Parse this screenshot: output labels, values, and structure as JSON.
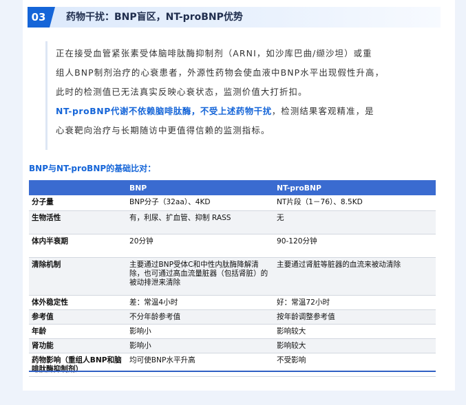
{
  "section": {
    "number": "03",
    "title": "药物干扰：BNP盲区，NT-proBNP优势"
  },
  "intro": {
    "line1": "正在接受血管紧张素受体脑啡肽酶抑制剂（ARNI，如沙库巴曲/缬沙坦）或重",
    "line2": "组人BNP制剂治疗的心衰患者，外源性药物会使血液中BNP水平出现假性升高，",
    "line3": "此时的检测值已无法真实反映心衰状态，监测价值大打折扣。",
    "highlight": "NT-proBNP代谢不依赖脑啡肽酶，不受上述药物干扰",
    "line4_rest": "，检测结果客观精准，是",
    "line5": "心衰靶向治疗与长期随访中更值得信赖的监测指标。"
  },
  "comparison": {
    "title": "BNP与NT-proBNP的基础比对：",
    "headers": [
      "",
      "BNP",
      "NT-proBNP"
    ],
    "rows": [
      [
        "分子量",
        "BNP分子（32aa）、4KD",
        "NT片段（1－76）、8.5KD"
      ],
      [
        "生物活性",
        "有，利尿、扩血管、抑制 RASS",
        "无"
      ],
      [
        "体内半衰期",
        "20分钟",
        "90-120分钟"
      ],
      [
        "清除机制",
        "主要通过BNP受体C和中性内肽酶降解清除，也可通过高血流量脏器（包括肾脏）的被动排泄来清除",
        "主要通过肾脏等脏器的血流来被动清除"
      ],
      [
        "体外稳定性",
        "差：常温4小时",
        "好：常温72小时"
      ],
      [
        "参考值",
        "不分年龄参考值",
        "按年龄调整参考值"
      ],
      [
        "年龄",
        "影响小",
        "影响较大"
      ],
      [
        "肾功能",
        "影响小",
        "影响较大"
      ],
      [
        "药物影响（重组人BNP和脑啡肽酶抑制剂）",
        "均可使BNP水平升高",
        "不受影响"
      ]
    ]
  },
  "colors": {
    "accent": "#1565d8",
    "table_header": "#3a6bd0",
    "row_alt": "#f1f3f6",
    "page_bg": "#eef3fb"
  }
}
